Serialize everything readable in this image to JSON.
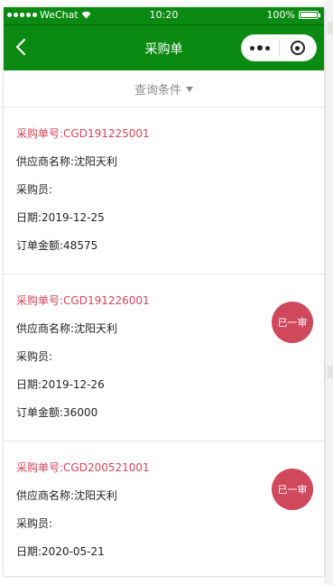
{
  "status_bar": {
    "carrier": "WeChat",
    "time": "10:20",
    "battery": "100%"
  },
  "nav": {
    "title": "采购单"
  },
  "filter": {
    "label": "查询条件"
  },
  "orders": [
    {
      "no": "采购单号:CGD191225001",
      "supplier": "供应商名称:沈阳天利",
      "buyer": "采购员:",
      "date": "日期:2019-12-25",
      "amount": "订单金额:48575",
      "badge": ""
    },
    {
      "no": "采购单号:CGD191226001",
      "supplier": "供应商名称:沈阳天利",
      "buyer": "采购员:",
      "date": "日期:2019-12-26",
      "amount": "订单金额:36000",
      "badge": "已一审"
    },
    {
      "no": "采购单号:CGD200521001",
      "supplier": "供应商名称:沈阳天利",
      "buyer": "采购员:",
      "date": "日期:2020-05-21",
      "amount": "",
      "badge": "已一审"
    }
  ]
}
